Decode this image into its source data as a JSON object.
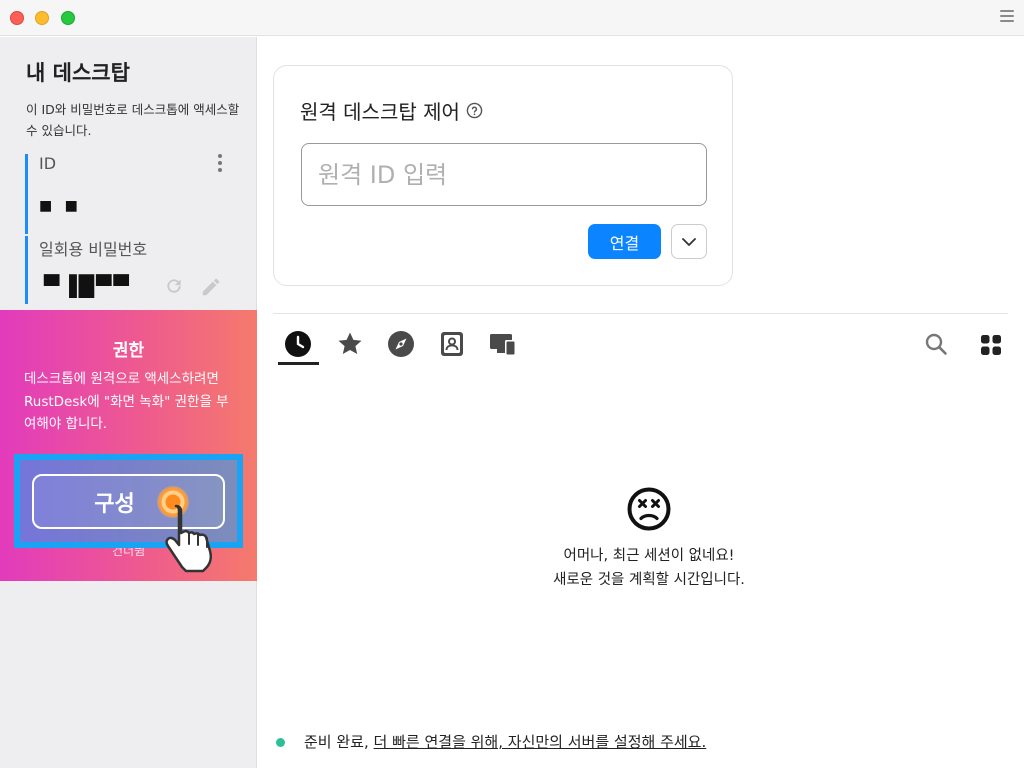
{
  "window": {
    "menu_icon": "hamburger-menu-icon"
  },
  "sidebar": {
    "title": "내 데스크탑",
    "description": "이 ID와 비밀번호로 데스크톱에 액세스할 수 있습니다.",
    "id_label": "ID",
    "id_value": "■ ■",
    "password_label": "일회용 비밀번호",
    "password_value": "▀▐█▀▀",
    "colors": {
      "accent": "#1a8cff"
    }
  },
  "permission": {
    "title": "권한",
    "text": "데스크톱에 원격으로 액세스하려면 RustDesk에 \"화면 녹화\" 권한을 부여해야 합니다.",
    "button_label": "구성",
    "sub_label": "건너뜀",
    "colors": {
      "gradient_start": "#e23bbd",
      "gradient_end": "#f57a6c",
      "highlight": "#19a3f5"
    }
  },
  "remote": {
    "title": "원격 데스크탑 제어",
    "input_placeholder": "원격 ID 입력",
    "input_value": "",
    "connect_label": "연결",
    "colors": {
      "connect": "#0a84ff"
    }
  },
  "tabs": {
    "items": [
      "recent-sessions-icon",
      "favorites-icon",
      "discovered-icon",
      "address-book-icon",
      "group-icon"
    ],
    "active": "recent-sessions-icon",
    "search_icon": "search-icon",
    "view_icon": "grid-view-icon"
  },
  "empty": {
    "icon": "sad-face-icon",
    "line1": "어머나, 최근 세션이 없네요!",
    "line2": "새로운 것을 계획할 시간입니다."
  },
  "status": {
    "ready": "준비 완료,",
    "link": "더 빠른 연결을 위해, 자신만의 서버를 설정해 주세요.",
    "colors": {
      "dot": "#2bbf9a"
    }
  }
}
